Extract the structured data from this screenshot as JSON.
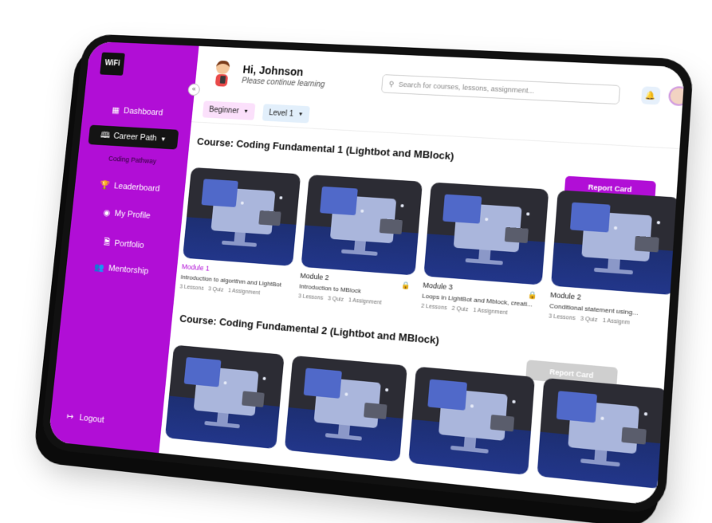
{
  "sidebar": {
    "logo_text": "WiFi",
    "collapse_glyph": "«",
    "items": [
      {
        "label": "Dashboard",
        "icon": "dashboard-icon",
        "glyph": "▦"
      },
      {
        "label": "Career Path",
        "icon": "book-icon",
        "glyph": "🕮"
      },
      {
        "label": "Leaderboard",
        "icon": "trophy-icon",
        "glyph": "🏆"
      },
      {
        "label": "My Profile",
        "icon": "user-icon",
        "glyph": "◉"
      },
      {
        "label": "Portfolio",
        "icon": "document-icon",
        "glyph": "🗎"
      },
      {
        "label": "Mentorship",
        "icon": "group-icon",
        "glyph": "👥"
      }
    ],
    "sub_item": "Coding Pathway",
    "logout_label": "Logout",
    "logout_glyph": "↦"
  },
  "header": {
    "greeting": "Hi, Johnson",
    "subtitle": "Please continue learning",
    "search_placeholder": "Search for courses, lessons, assignment...",
    "search_glyph": "⚲",
    "bell_glyph": "🔔"
  },
  "filters": [
    {
      "label": "Beginner",
      "bg": "#fbe0fb"
    },
    {
      "label": "Level 1",
      "bg": "#e2effb"
    }
  ],
  "courses": [
    {
      "title": "Course: Coding Fundamental 1 (Lightbot and MBlock)",
      "report_label": "Report Card",
      "report_color": "#b10ed6",
      "modules": [
        {
          "label": "Module 1",
          "label_color": "#b10ed6",
          "desc": "Introduction to algorithm and LightBot",
          "lessons": "3 Lessons",
          "quiz": "3 Quiz",
          "assign": "1 Assignment",
          "locked": false
        },
        {
          "label": "Module 2",
          "label_color": "#222222",
          "desc": "Introduction to MBlock",
          "lessons": "3 Lessons",
          "quiz": "3 Quiz",
          "assign": "1 Assignment",
          "locked": true
        },
        {
          "label": "Module 3",
          "label_color": "#222222",
          "desc": "Loops in LightBot and Mblock, creati...",
          "lessons": "2 Lessons",
          "quiz": "2 Quiz",
          "assign": "1 Assignment",
          "locked": true
        },
        {
          "label": "Module 2",
          "label_color": "#222222",
          "desc": "Conditional statement using...",
          "lessons": "3 Lessons",
          "quiz": "3 Quiz",
          "assign": "1 Assignm",
          "locked": false
        }
      ]
    },
    {
      "title": "Course: Coding Fundamental 2 (Lightbot and MBlock)",
      "report_label": "Report Card",
      "report_color": "#cfcfcf"
    }
  ]
}
